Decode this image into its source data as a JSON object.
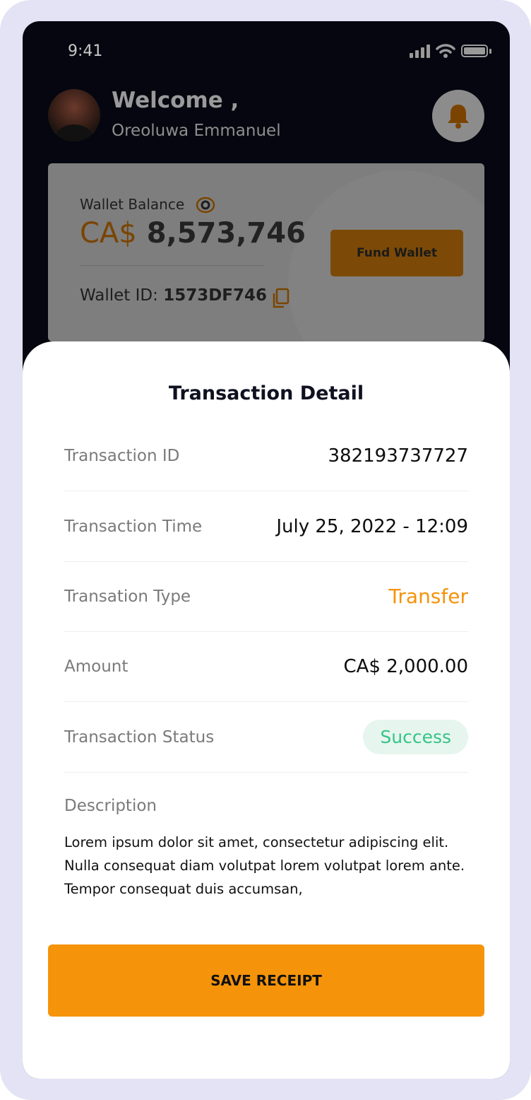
{
  "status_bar": {
    "time": "9:41"
  },
  "header": {
    "welcome": "Welcome ,",
    "user_name": "Oreoluwa Emmanuel"
  },
  "wallet": {
    "balance_label": "Wallet Balance",
    "currency": "CA$",
    "balance": "8,573,746",
    "id_label": "Wallet ID:",
    "id_value": "1573DF746",
    "fund_button": "Fund Wallet"
  },
  "transaction_detail": {
    "title": "Transaction Detail",
    "rows": [
      {
        "label": "Transaction ID",
        "value": "382193737727"
      },
      {
        "label": "Transaction Time",
        "value": "July 25, 2022 - 12:09"
      },
      {
        "label": "Transation Type",
        "value": "Transfer"
      },
      {
        "label": "Amount",
        "value": "CA$ 2,000.00"
      },
      {
        "label": "Transaction Status",
        "value": "Success"
      }
    ],
    "description_label": "Description",
    "description_text": "Lorem ipsum dolor sit amet, consectetur adipiscing elit. Nulla consequat diam volutpat lorem volutpat lorem ante. Tempor consequat duis accumsan,",
    "save_button": "SAVE RECEIPT"
  },
  "colors": {
    "accent": "#f5940a",
    "success": "#36c486",
    "success_bg": "#e6f6ee",
    "dark_bg": "#05060f",
    "frame": "#e3e3f5"
  },
  "icons": [
    "signal-icon",
    "wifi-icon",
    "battery-icon",
    "bell-icon",
    "eye-icon",
    "copy-icon"
  ]
}
